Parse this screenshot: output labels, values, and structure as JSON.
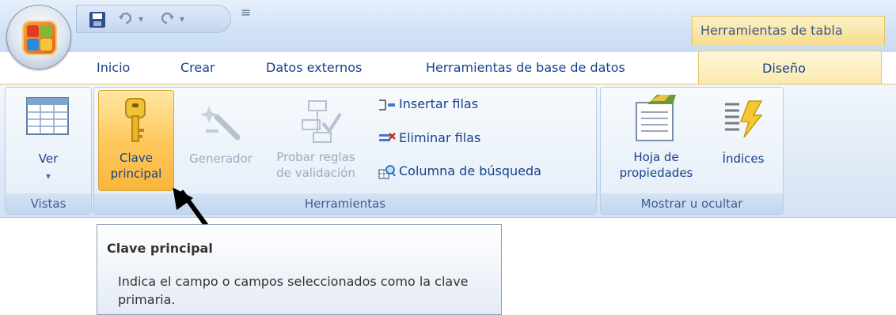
{
  "quick_access": {
    "undo_icon": "undo-arrow-icon",
    "redo_icon": "redo-arrow-icon",
    "customize_glyph": "≡"
  },
  "context_header": {
    "label": "Herramientas de tabla"
  },
  "tabs": [
    {
      "label": "Inicio"
    },
    {
      "label": "Crear"
    },
    {
      "label": "Datos externos"
    },
    {
      "label": "Herramientas de base de datos"
    },
    {
      "label": "Diseño",
      "active": true
    }
  ],
  "ribbon": {
    "vistas": {
      "label": "Vistas",
      "ver": {
        "label": "Ver",
        "dropdown_glyph": "▾"
      }
    },
    "herramientas": {
      "label": "Herramientas",
      "clave_principal": {
        "line1": "Clave",
        "line2": "principal"
      },
      "generador": {
        "label": "Generador"
      },
      "probar_reglas": {
        "line1": "Probar reglas",
        "line2": "de validación"
      },
      "insertar_filas": {
        "label": "Insertar filas"
      },
      "eliminar_filas": {
        "label": "Eliminar filas"
      },
      "columna_busqueda": {
        "label": "Columna de búsqueda"
      }
    },
    "mostrar": {
      "label": "Mostrar u ocultar",
      "hoja_propiedades": {
        "line1": "Hoja de",
        "line2": "propiedades"
      },
      "indices": {
        "label": "Índices"
      }
    }
  },
  "tooltip": {
    "title": "Clave principal",
    "body": "Indica el campo o campos seleccionados como la clave primaria."
  },
  "colors": {
    "ribbon_text": "#15428b",
    "active_tab": "#fbe9a9",
    "pressed_button": "#ffc95e",
    "disabled_text": "#9bacbf"
  }
}
